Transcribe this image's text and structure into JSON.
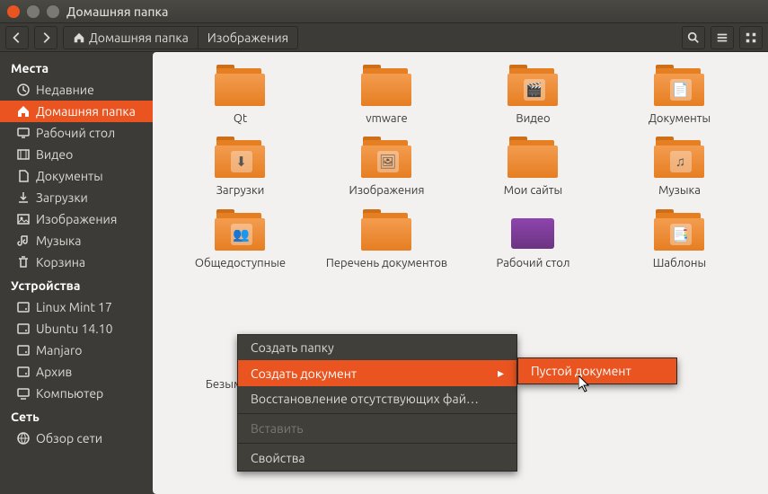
{
  "window": {
    "title": "Домашняя папка"
  },
  "path": {
    "home": "Домашняя папка",
    "current": "Изображения"
  },
  "sidebar": {
    "sections": [
      {
        "title": "Места",
        "items": [
          {
            "icon": "clock",
            "label": "Недавние"
          },
          {
            "icon": "home",
            "label": "Домашняя папка",
            "active": true
          },
          {
            "icon": "desktop",
            "label": "Рабочий стол"
          },
          {
            "icon": "video",
            "label": "Видео"
          },
          {
            "icon": "doc",
            "label": "Документы"
          },
          {
            "icon": "download",
            "label": "Загрузки"
          },
          {
            "icon": "pic",
            "label": "Изображения"
          },
          {
            "icon": "music",
            "label": "Музыка"
          },
          {
            "icon": "trash",
            "label": "Корзина"
          }
        ]
      },
      {
        "title": "Устройства",
        "items": [
          {
            "icon": "disk",
            "label": "Linux Mint 17"
          },
          {
            "icon": "disk",
            "label": "Ubuntu 14.10"
          },
          {
            "icon": "disk",
            "label": "Manjaro"
          },
          {
            "icon": "disk",
            "label": "Архив"
          },
          {
            "icon": "computer",
            "label": "Компьютер"
          }
        ]
      },
      {
        "title": "Сеть",
        "items": [
          {
            "icon": "net",
            "label": "Обзор сети"
          }
        ]
      }
    ]
  },
  "items": [
    {
      "label": "Qt",
      "overlay": ""
    },
    {
      "label": "vmware",
      "overlay": ""
    },
    {
      "label": "Видео",
      "overlay": "video"
    },
    {
      "label": "Документы",
      "overlay": "doc"
    },
    {
      "label": "Загрузки",
      "overlay": "download"
    },
    {
      "label": "Изображения",
      "overlay": "pic"
    },
    {
      "label": "Мои сайты",
      "overlay": ""
    },
    {
      "label": "Музыка",
      "overlay": "music"
    },
    {
      "label": "Общедоступные",
      "overlay": "share"
    },
    {
      "label": "Перечень документов",
      "overlay": ""
    },
    {
      "label": "Рабочий стол",
      "overlay": "desktop"
    },
    {
      "label": "Шаблоны",
      "overlay": "tpl"
    }
  ],
  "extra_item": {
    "label": "Безымянный документ"
  },
  "menu": {
    "create_folder": "Создать папку",
    "create_doc": "Создать документ",
    "restore": "Восстановление отсутствующих фай…",
    "paste": "Вставить",
    "props": "Свойства",
    "empty_doc": "Пустой документ"
  }
}
